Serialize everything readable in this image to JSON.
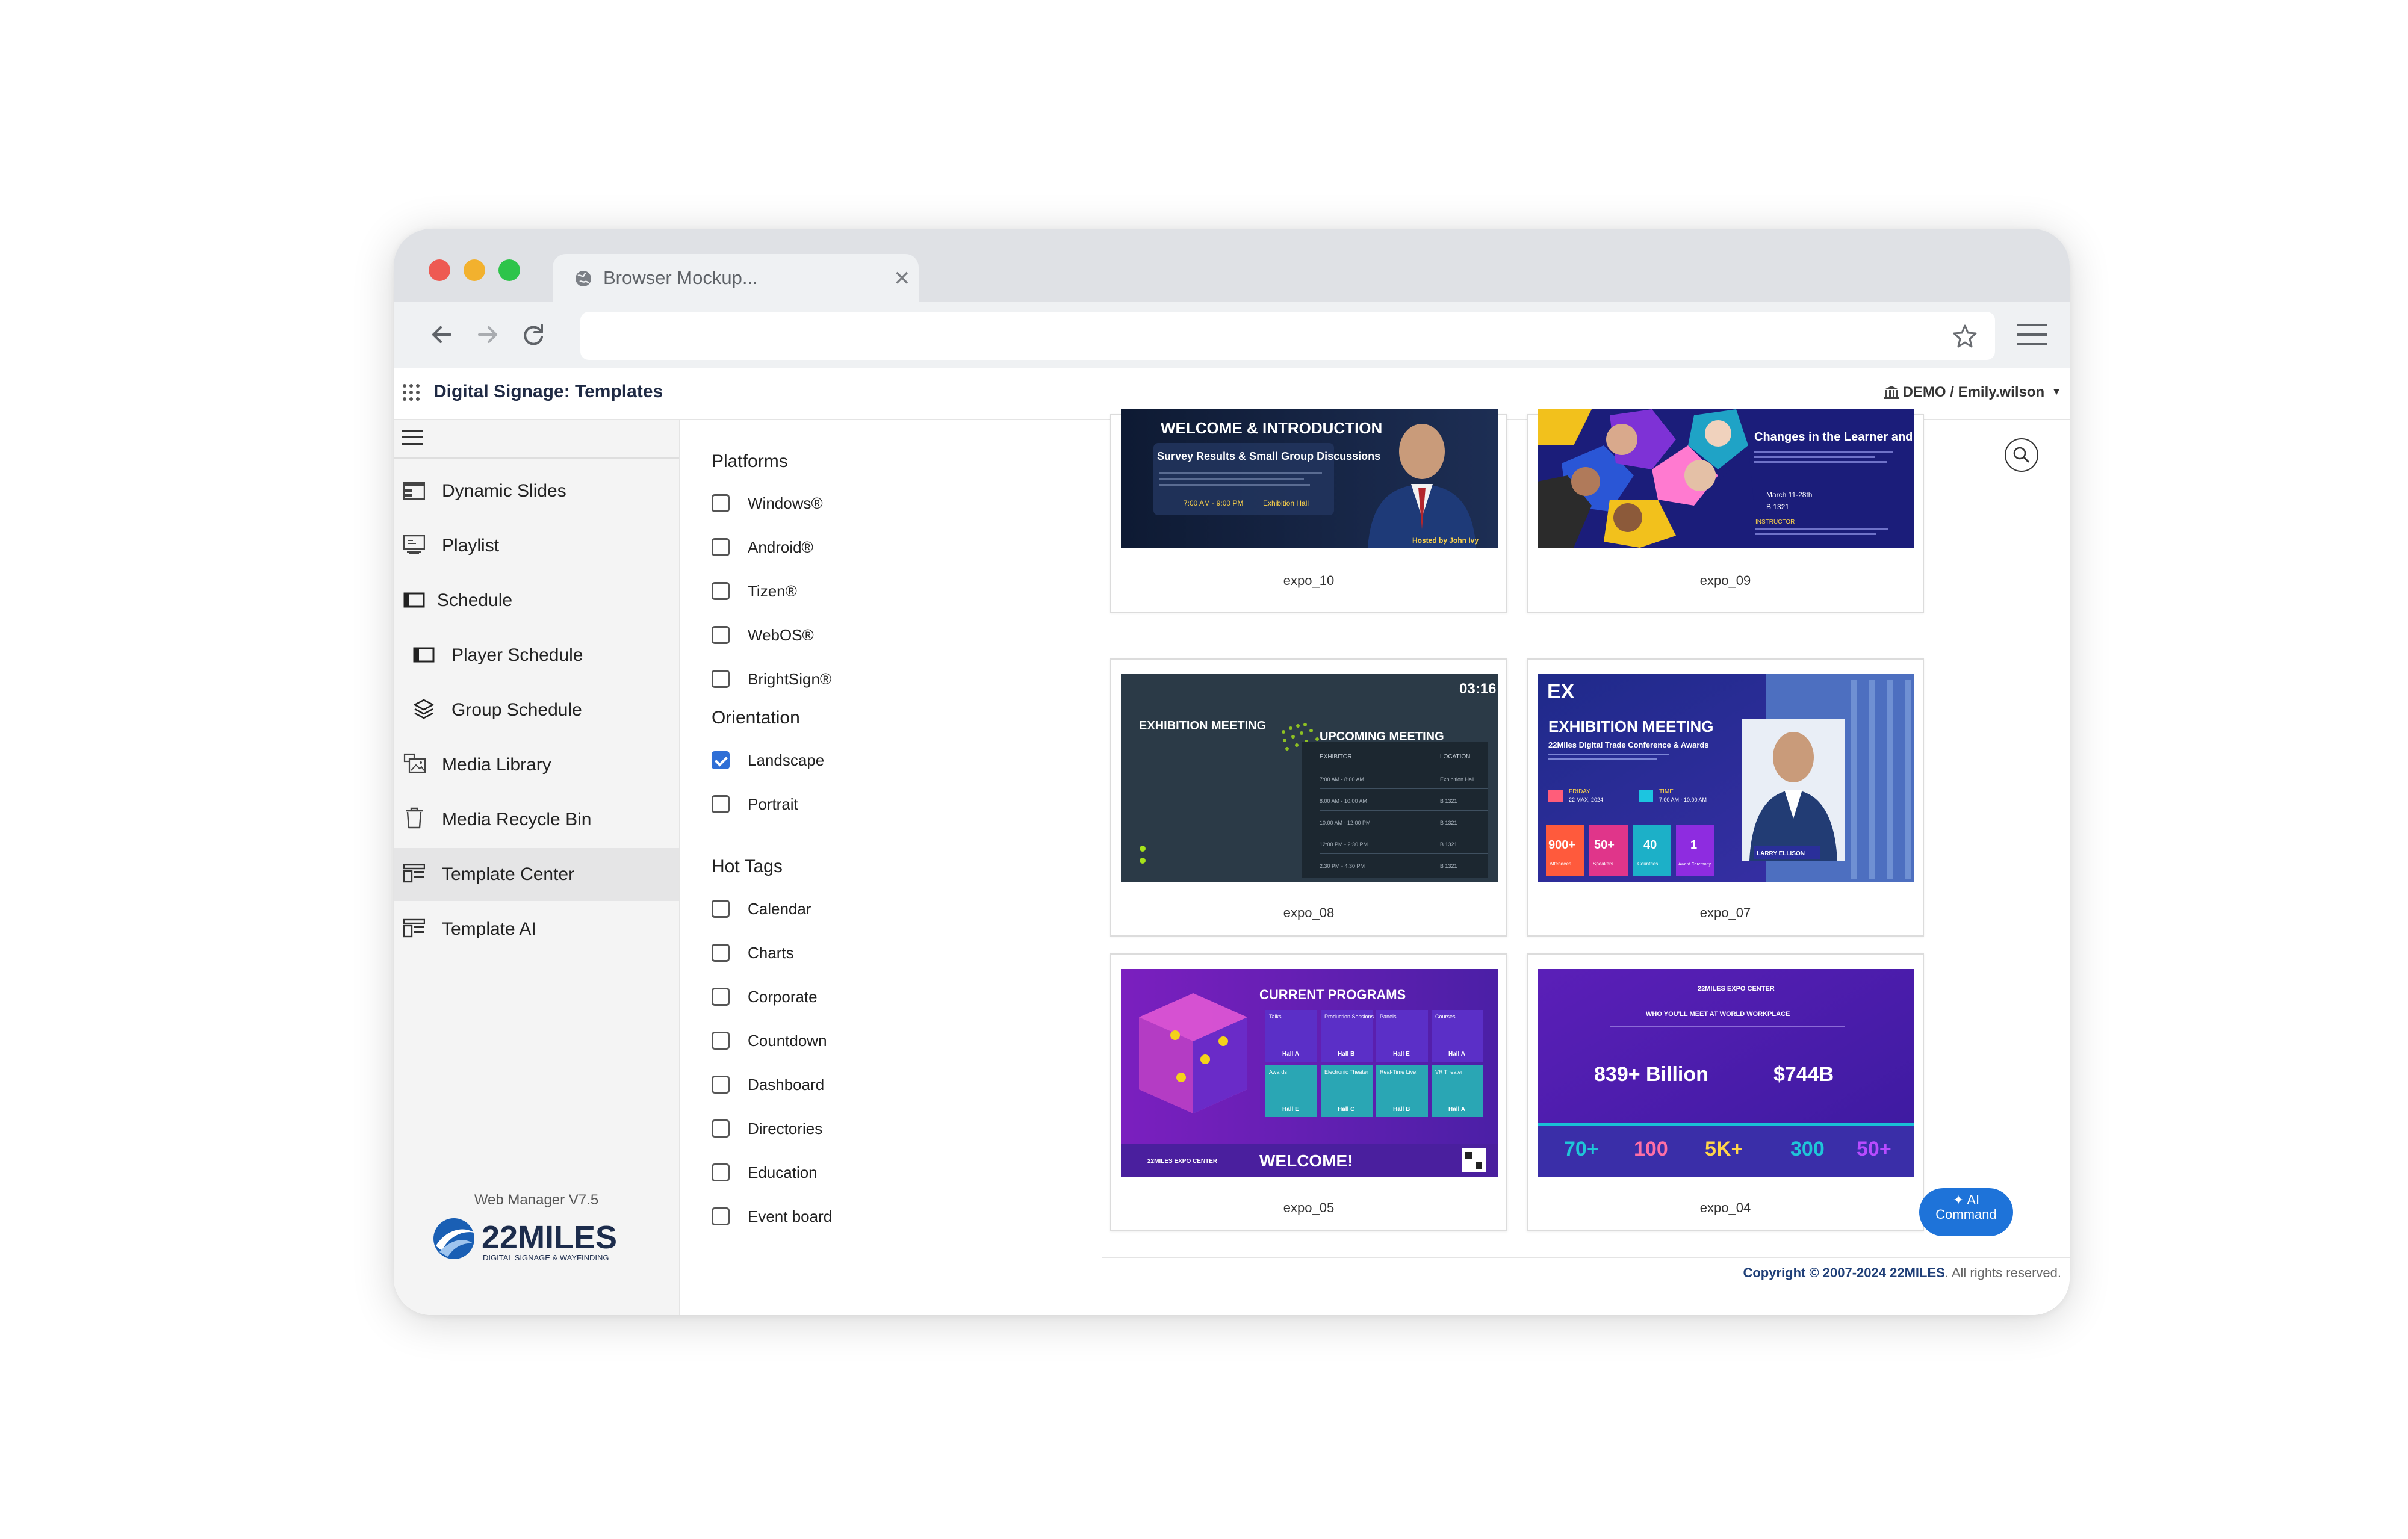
{
  "browser": {
    "tab_title": "Browser Mockup...",
    "url": ""
  },
  "app": {
    "title": "Digital Signage: Templates",
    "user": "DEMO / Emily.wilson"
  },
  "sidebar": {
    "items": [
      {
        "label": "Dynamic Slides",
        "icon": "slides-icon"
      },
      {
        "label": "Playlist",
        "icon": "playlist-icon"
      },
      {
        "label": "Schedule",
        "icon": "schedule-icon"
      },
      {
        "label": "Player Schedule",
        "icon": "player-schedule-icon"
      },
      {
        "label": "Group Schedule",
        "icon": "layers-icon"
      },
      {
        "label": "Media Library",
        "icon": "media-library-icon"
      },
      {
        "label": "Media Recycle Bin",
        "icon": "trash-icon"
      },
      {
        "label": "Template Center",
        "icon": "template-icon",
        "active": true
      },
      {
        "label": "Template AI",
        "icon": "template-ai-icon"
      }
    ],
    "version": "Web Manager V7.5",
    "logo_text": "22MILES",
    "logo_subtext": "DIGITAL SIGNAGE & WAYFINDING"
  },
  "filters": {
    "platforms": {
      "heading": "Platforms",
      "options": [
        {
          "label": "Windows®",
          "checked": false
        },
        {
          "label": "Android®",
          "checked": false
        },
        {
          "label": "Tizen®",
          "checked": false
        },
        {
          "label": "WebOS®",
          "checked": false
        },
        {
          "label": "BrightSign®",
          "checked": false
        }
      ]
    },
    "orientation": {
      "heading": "Orientation",
      "options": [
        {
          "label": "Landscape",
          "checked": true
        },
        {
          "label": "Portrait",
          "checked": false
        }
      ]
    },
    "hot_tags": {
      "heading": "Hot Tags",
      "options": [
        {
          "label": "Calendar",
          "checked": false
        },
        {
          "label": "Charts",
          "checked": false
        },
        {
          "label": "Corporate",
          "checked": false
        },
        {
          "label": "Countdown",
          "checked": false
        },
        {
          "label": "Dashboard",
          "checked": false
        },
        {
          "label": "Directories",
          "checked": false
        },
        {
          "label": "Education",
          "checked": false
        },
        {
          "label": "Event board",
          "checked": false
        }
      ]
    }
  },
  "templates": [
    {
      "name": "expo_10",
      "thumb": {
        "title": "WELCOME & INTRODUCTION",
        "subtitle": "Survey Results & Small Group Discussions",
        "time": "7:00 AM - 9:00 PM",
        "place": "Exhibition Hall",
        "host": "Hosted by John Ivy"
      }
    },
    {
      "name": "expo_09",
      "thumb": {
        "title": "Changes in the Learner and Learning",
        "date": "March 11-28th",
        "room": "B 1321",
        "instructor_label": "INSTRUCTOR"
      }
    },
    {
      "name": "expo_08",
      "thumb": {
        "clock": "03:16",
        "left_title": "EXHIBITION MEETING",
        "title": "UPCOMING MEETING",
        "col1": "EXHIBITOR",
        "col2": "LOCATION",
        "rows": [
          "7:00 AM - 8:00 AM",
          "8:00 AM - 10:00 AM",
          "10:00 AM - 12:00 PM",
          "12:00 PM - 2:30 PM",
          "2:30 PM - 4:30 PM"
        ],
        "locs": [
          "Exhibition Hall",
          "B 1321",
          "B 1321",
          "B 1321",
          "B 1321"
        ]
      }
    },
    {
      "name": "expo_07",
      "thumb": {
        "logo": "EX",
        "title": "EXHIBITION MEETING",
        "subtitle": "22Miles Digital Trade Conference & Awards",
        "date_label": "FRIDAY",
        "date": "22 MAX, 2024",
        "time_label": "TIME",
        "time": "7:00 AM - 10:00 AM",
        "stats": [
          "900+",
          "50+",
          "40",
          "1"
        ],
        "stat_labels": [
          "Attendees",
          "Speakers",
          "Countries",
          "Award Ceremony"
        ],
        "instructor": "LARRY ELLISON"
      }
    },
    {
      "name": "expo_05",
      "thumb": {
        "title": "CURRENT PROGRAMS",
        "cells": [
          "Talks",
          "Production Sessions",
          "Panels",
          "Courses",
          "Awards",
          "Electronic Theater",
          "Real-Time Live!",
          "VR Theater"
        ],
        "halls": [
          "Hall A",
          "Hall B",
          "Hall E",
          "Hall A",
          "Hall E",
          "Hall C",
          "Hall B",
          "Hall A"
        ],
        "welcome": "WELCOME!",
        "brand": "22MILES EXPO CENTER"
      }
    },
    {
      "name": "expo_04",
      "thumb": {
        "brand": "22MILES EXPO CENTER",
        "headline": "WHO YOU'LL MEET AT WORLD WORKPLACE",
        "big1": "839+ Billion",
        "big2": "$744B",
        "stats": [
          "70+",
          "100",
          "5K+",
          "300",
          "50+"
        ]
      }
    }
  ],
  "ai_command": {
    "line1": "AI",
    "line2": "Command"
  },
  "footer": {
    "copyright": "Copyright © 2007-2024",
    "brand": "22MILES",
    "rights": ". All rights reserved."
  },
  "colors": {
    "accent": "#2f6fd6",
    "sidebar_bg": "#f4f4f4",
    "active_bg": "#e5e5e6",
    "ai_button": "#1e73d9"
  }
}
